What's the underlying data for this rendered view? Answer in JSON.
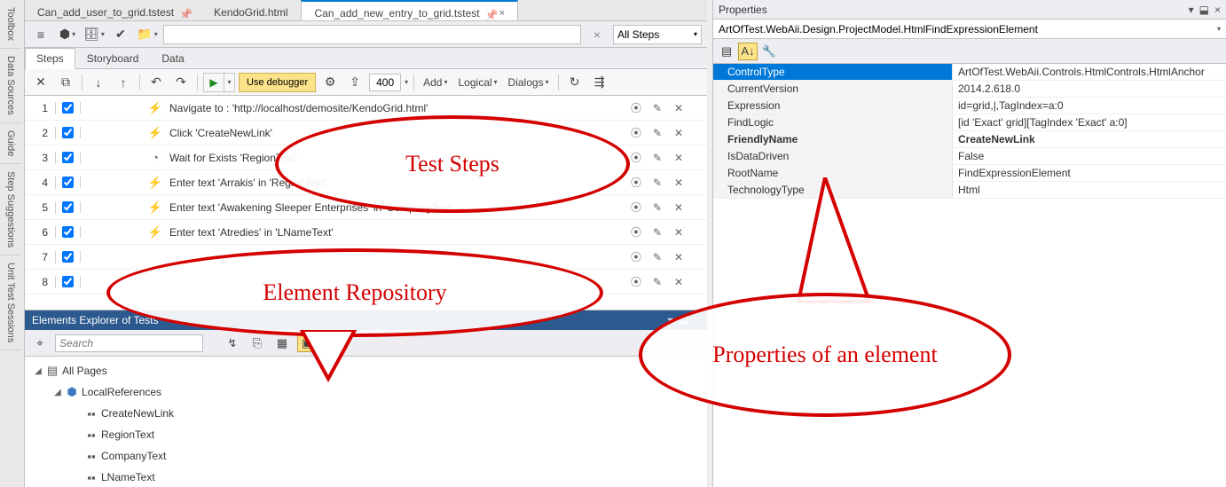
{
  "sidebar_tabs": [
    "Toolbox",
    "Data Sources",
    "Guide",
    "Step Suggestions",
    "Unit Test Sessions"
  ],
  "doc_tabs": [
    {
      "label": "Can_add_user_to_grid.tstest",
      "active": false
    },
    {
      "label": "KendoGrid.html",
      "active": false
    },
    {
      "label": "Can_add_new_entry_to_grid.tstest",
      "active": true
    }
  ],
  "search_clear": "×",
  "step_filter": {
    "label": "All Steps",
    "arrow": "▾"
  },
  "sub_tabs": {
    "steps": "Steps",
    "storyboard": "Storyboard",
    "data": "Data"
  },
  "toolbar2": {
    "debugger": "Use debugger",
    "delay": "400",
    "menus": {
      "add": "Add",
      "logical": "Logical",
      "dialogs": "Dialogs"
    }
  },
  "steps": [
    {
      "n": 1,
      "icon": "⚡",
      "text": "Navigate to : 'http://localhost/demosite/KendoGrid.html'"
    },
    {
      "n": 2,
      "icon": "⚡",
      "text": "Click 'CreateNewLink'"
    },
    {
      "n": 3,
      "icon": "◔",
      "text": "Wait for Exists 'RegionText'"
    },
    {
      "n": 4,
      "icon": "⚡",
      "text": "Enter text 'Arrakis' in 'RegionText'"
    },
    {
      "n": 5,
      "icon": "⚡",
      "text": "Enter text 'Awakening Sleeper Enterprises' in 'CompanyText'"
    },
    {
      "n": 6,
      "icon": "⚡",
      "text": "Enter text 'Atredies' in 'LNameText'"
    },
    {
      "n": 7,
      "icon": "",
      "text": ""
    },
    {
      "n": 8,
      "icon": "",
      "text": ""
    }
  ],
  "elements": {
    "header": "Elements Explorer of Tests",
    "search_placeholder": "Search",
    "tree": {
      "all_pages": "All Pages",
      "local_refs": "LocalReferences",
      "items": [
        "CreateNewLink",
        "RegionText",
        "CompanyText",
        "LNameText"
      ]
    }
  },
  "properties": {
    "title": "Properties",
    "object": "ArtOfTest.WebAii.Design.ProjectModel.HtmlFindExpressionElement",
    "rows": [
      {
        "name": "ControlType",
        "value": "ArtOfTest.WebAii.Controls.HtmlControls.HtmlAnchor",
        "selected": true
      },
      {
        "name": "CurrentVersion",
        "value": "2014.2.618.0"
      },
      {
        "name": "Expression",
        "value": "id=grid,|,TagIndex=a:0"
      },
      {
        "name": "FindLogic",
        "value": "[id 'Exact' grid][TagIndex 'Exact' a:0]"
      },
      {
        "name": "FriendlyName",
        "value": "CreateNewLink",
        "bold": true
      },
      {
        "name": "IsDataDriven",
        "value": "False"
      },
      {
        "name": "RootName",
        "value": "FindExpressionElement"
      },
      {
        "name": "TechnologyType",
        "value": "Html"
      }
    ]
  },
  "callouts": {
    "steps": "Test Steps",
    "repo": "Element Repository",
    "props": "Properties of an element"
  }
}
